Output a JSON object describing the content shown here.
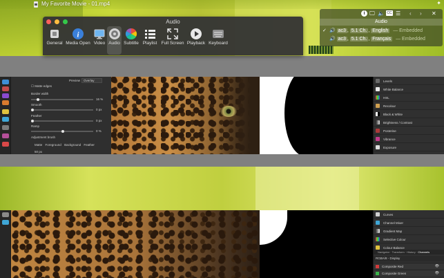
{
  "window": {
    "title": "My Favorite Movie - 01.mp4"
  },
  "preferences": {
    "title": "Audio",
    "tabs": [
      {
        "label": "General",
        "icon": "switch-icon"
      },
      {
        "label": "Media Open",
        "icon": "info-icon"
      },
      {
        "label": "Video",
        "icon": "monitor-icon"
      },
      {
        "label": "Audio",
        "icon": "speaker-icon",
        "selected": true
      },
      {
        "label": "Subtitle",
        "icon": "color-wheel-icon"
      },
      {
        "label": "Playlist",
        "icon": "list-icon"
      },
      {
        "label": "Full Screen",
        "icon": "expand-icon"
      },
      {
        "label": "Playback",
        "icon": "play-icon"
      },
      {
        "label": "Keyboard",
        "icon": "keyboard-icon"
      }
    ]
  },
  "audio_osd": {
    "icons": [
      "info-icon",
      "monitor-icon",
      "speaker-icon",
      "subtitle-icon",
      "list-icon",
      "chevron-left-icon",
      "chevron-right-icon",
      "close-icon"
    ],
    "header": "Audio",
    "tracks": [
      {
        "check": "✓",
        "codec": "ac3",
        "channels": "5.1 Ch.",
        "language": "English",
        "note": "— Embedded",
        "selected": true
      },
      {
        "check": "",
        "codec": "ac3",
        "channels": "5.1 Ch.",
        "language": "Français",
        "note": "— Embedded",
        "selected": false
      }
    ]
  },
  "editor_top": {
    "context": {
      "preview_label": "Preview",
      "preview_value": "Overlay",
      "matte_edges": "Matte edges",
      "border_width_label": "Border width",
      "border_width_value": "16 %",
      "smooth_label": "Smooth",
      "smooth_value": "0 px",
      "feather_label": "Feather",
      "feather_value": "0 px",
      "ramp_label": "Ramp",
      "ramp_value": "0 %",
      "brush_label": "Adjustment brush",
      "brush_tabs": [
        "Matte",
        "Foreground",
        "Background",
        "Feather"
      ],
      "size_value": "50 px"
    },
    "adjustments": [
      "Levels",
      "White Balance",
      "HSL",
      "Recolour",
      "Black & White",
      "Brightness / Contrast",
      "Posterise",
      "Vibrance",
      "Exposure"
    ]
  },
  "editor_bottom": {
    "adjustments": [
      "Curves",
      "Channel Mixer",
      "Gradient Map",
      "Selective Colour",
      "Colour Balance"
    ],
    "panel_tabs": [
      "Navigator",
      "Transform",
      "History",
      "Channels"
    ],
    "channels_header": "RGBA/8 - Display",
    "channels": [
      {
        "name": "Composite Red",
        "color": "#d23b3b"
      },
      {
        "name": "Composite Green",
        "color": "#3bb44a"
      }
    ]
  }
}
